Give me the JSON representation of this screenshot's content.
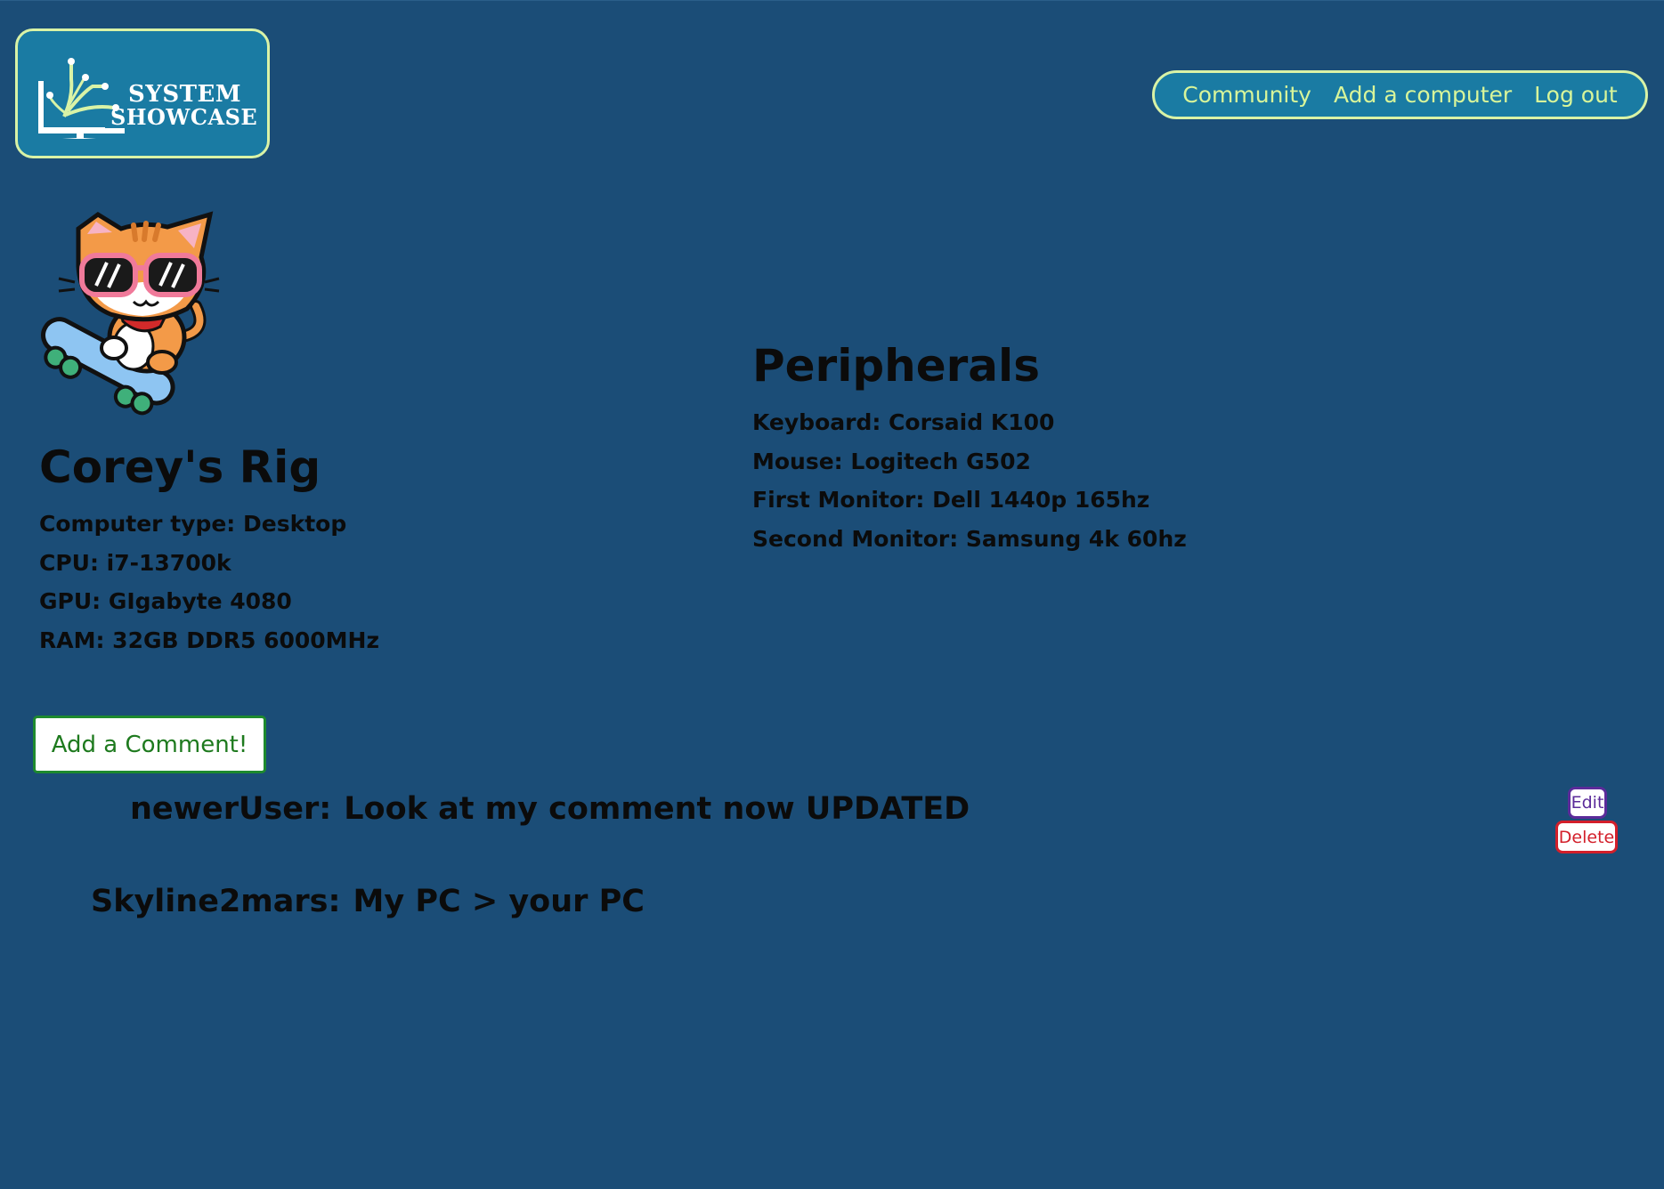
{
  "header": {
    "logo": {
      "line1": "SYSTEM",
      "line2": "SHOWCASE",
      "icon": "monitor-circuit-icon"
    },
    "nav": [
      {
        "label": "Community"
      },
      {
        "label": "Add a computer"
      },
      {
        "label": "Log out"
      }
    ]
  },
  "avatar": {
    "icon": "cat-skateboard-sunglasses-icon"
  },
  "rig": {
    "title": "Corey's Rig",
    "specs": [
      "Computer type: Desktop",
      "CPU: i7-13700k",
      "GPU: GIgabyte 4080",
      "RAM: 32GB DDR5 6000MHz"
    ]
  },
  "peripherals": {
    "title": "Peripherals",
    "items": [
      "Keyboard: Corsaid K100",
      "Mouse: Logitech G502",
      "First Monitor: Dell 1440p 165hz",
      "Second Monitor: Samsung 4k 60hz"
    ]
  },
  "comments": {
    "add_label": "Add a Comment!",
    "items": [
      {
        "user": "newerUser:",
        "text": "Look at my comment now UPDATED",
        "edit_label": "Edit",
        "delete_label": "Delete"
      },
      {
        "user": "Skyline2mars:",
        "text": "My PC > your PC"
      }
    ]
  },
  "colors": {
    "background": "#1b4d77",
    "panel": "#1a7ba3",
    "accent": "#d9f3a6",
    "nav_text": "#d8f59a",
    "add_button": "#1e8a2e",
    "edit": "#5b2b9a",
    "delete": "#d31f2a"
  }
}
